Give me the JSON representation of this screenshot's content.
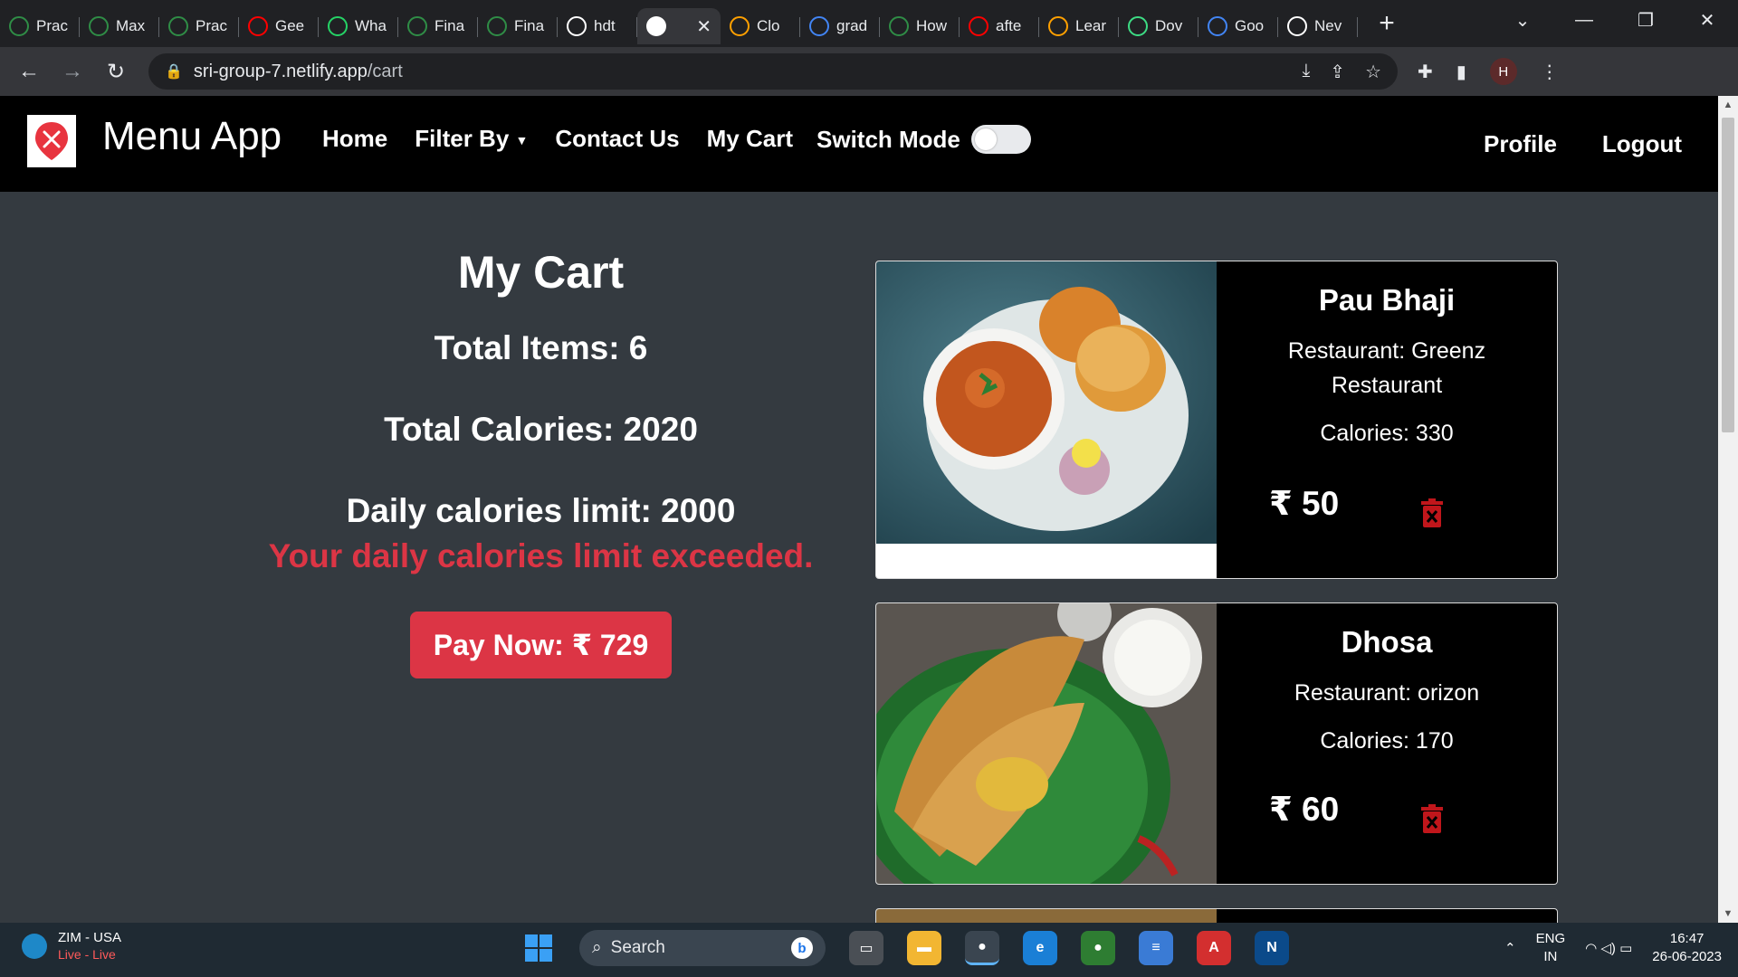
{
  "browser": {
    "tabs": [
      {
        "label": "Prac",
        "icon": "geeksforgeeks-icon",
        "color": "#2f8d46"
      },
      {
        "label": "Max",
        "icon": "geeksforgeeks-icon",
        "color": "#2f8d46"
      },
      {
        "label": "Prac",
        "icon": "geeksforgeeks-icon",
        "color": "#2f8d46"
      },
      {
        "label": "Gee",
        "icon": "youtube-icon",
        "color": "#ff0000"
      },
      {
        "label": "Wha",
        "icon": "whatsapp-icon",
        "color": "#25d366"
      },
      {
        "label": "Fina",
        "icon": "leaf-icon",
        "color": "#2f8d46"
      },
      {
        "label": "Fina",
        "icon": "leaf-icon",
        "color": "#2f8d46"
      },
      {
        "label": "hdt",
        "icon": "github-icon",
        "color": "#ffffff"
      },
      {
        "label": "",
        "icon": "menu-app-icon",
        "color": "#e8343f",
        "active": true
      },
      {
        "label": "Clo",
        "icon": "firebase-icon",
        "color": "#ffa000"
      },
      {
        "label": "grad",
        "icon": "google-icon",
        "color": "#4285f4"
      },
      {
        "label": "How",
        "icon": "geeksforgeeks-icon",
        "color": "#2f8d46"
      },
      {
        "label": "afte",
        "icon": "youtube-icon",
        "color": "#ff0000"
      },
      {
        "label": "Lear",
        "icon": "firebase-icon",
        "color": "#ffa000"
      },
      {
        "label": "Dov",
        "icon": "android-icon",
        "color": "#3ddc84"
      },
      {
        "label": "Goo",
        "icon": "google-icon",
        "color": "#4285f4"
      },
      {
        "label": "Nev",
        "icon": "chrome-icon",
        "color": "#ffffff"
      }
    ],
    "url_host": "sri-group-7.netlify.app",
    "url_path": "/cart",
    "avatar_letter": "H"
  },
  "navbar": {
    "brand": "Menu App",
    "links": {
      "home": "Home",
      "filter": "Filter By",
      "contact": "Contact Us",
      "cart": "My Cart"
    },
    "switch_label": "Switch Mode",
    "profile": "Profile",
    "logout": "Logout"
  },
  "summary": {
    "title": "My Cart",
    "total_items": "Total Items: 6",
    "total_calories": "Total Calories: 2020",
    "daily_limit": "Daily calories limit: 2000",
    "warning": "Your daily calories limit exceeded.",
    "pay_button": "Pay Now: ₹ 729"
  },
  "cart_items": [
    {
      "name": "Pau Bhaji",
      "restaurant": "Restaurant: Greenz Restaurant",
      "calories": "Calories: 330",
      "price": "₹ 50"
    },
    {
      "name": "Dhosa",
      "restaurant": "Restaurant: orizon",
      "calories": "Calories: 170",
      "price": "₹ 60"
    }
  ],
  "taskbar": {
    "weather_title": "ZIM - USA",
    "weather_sub": "Live - Live",
    "search_placeholder": "Search",
    "lang_1": "ENG",
    "lang_2": "IN",
    "time": "16:47",
    "date": "26-06-2023"
  },
  "colors": {
    "accent_red": "#dc3545",
    "page_bg": "#343a40",
    "navbar_bg": "#000000"
  }
}
